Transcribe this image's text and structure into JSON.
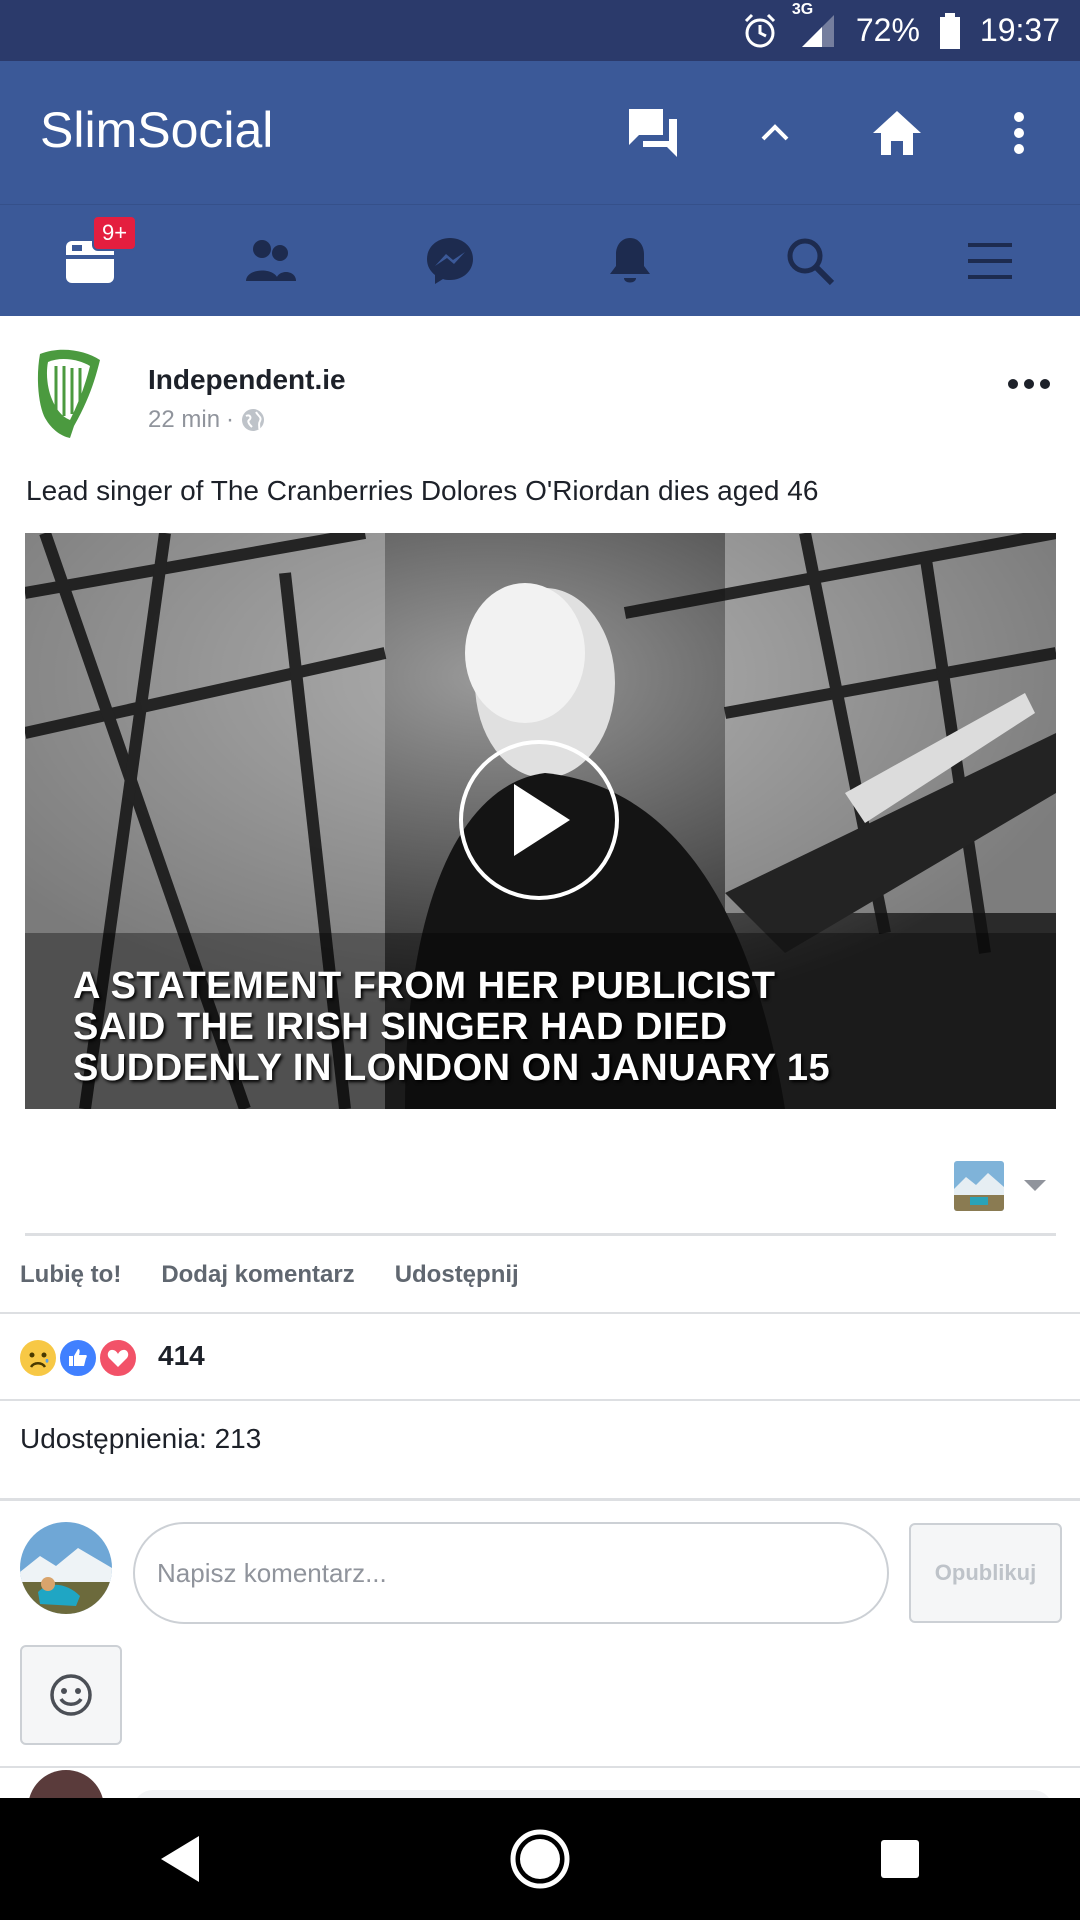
{
  "status_bar": {
    "network": "3G",
    "battery": "72%",
    "time": "19:37",
    "icons": [
      "alarm-icon",
      "signal-icon",
      "battery-icon"
    ]
  },
  "app_bar": {
    "title": "SlimSocial",
    "actions": [
      "messages-icon",
      "chevron-up-icon",
      "home-icon",
      "overflow-menu-icon"
    ]
  },
  "nav": {
    "items": [
      "news-feed-icon",
      "friends-icon",
      "messenger-icon",
      "notifications-icon",
      "search-icon",
      "menu-icon"
    ],
    "news_badge": "9+"
  },
  "post": {
    "page_name": "Independent.ie",
    "time": "22 min",
    "separator": "·",
    "text": "Lead singer of The Cranberries Dolores O'Riordan dies aged 46",
    "video_caption": [
      "A STATEMENT FROM HER PUBLICIST",
      "SAID THE IRISH SINGER HAD DIED",
      "SUDDENLY IN LONDON ON JANUARY 15"
    ],
    "actions": {
      "like": "Lubię to!",
      "comment": "Dodaj komentarz",
      "share": "Udostępnij"
    },
    "reactions": {
      "types": [
        "sad",
        "like",
        "love"
      ],
      "count": "414"
    },
    "shares_text": "Udostępnienia: 213"
  },
  "composer": {
    "placeholder": "Napisz komentarz...",
    "publish_label": "Opublikuj"
  },
  "colors": {
    "status_bar": "#2b3a6b",
    "brand": "#3b5998",
    "badge": "#e41e3f",
    "like_blue": "#4080ff",
    "love_red": "#f25268",
    "sad_yellow": "#f7c845"
  }
}
